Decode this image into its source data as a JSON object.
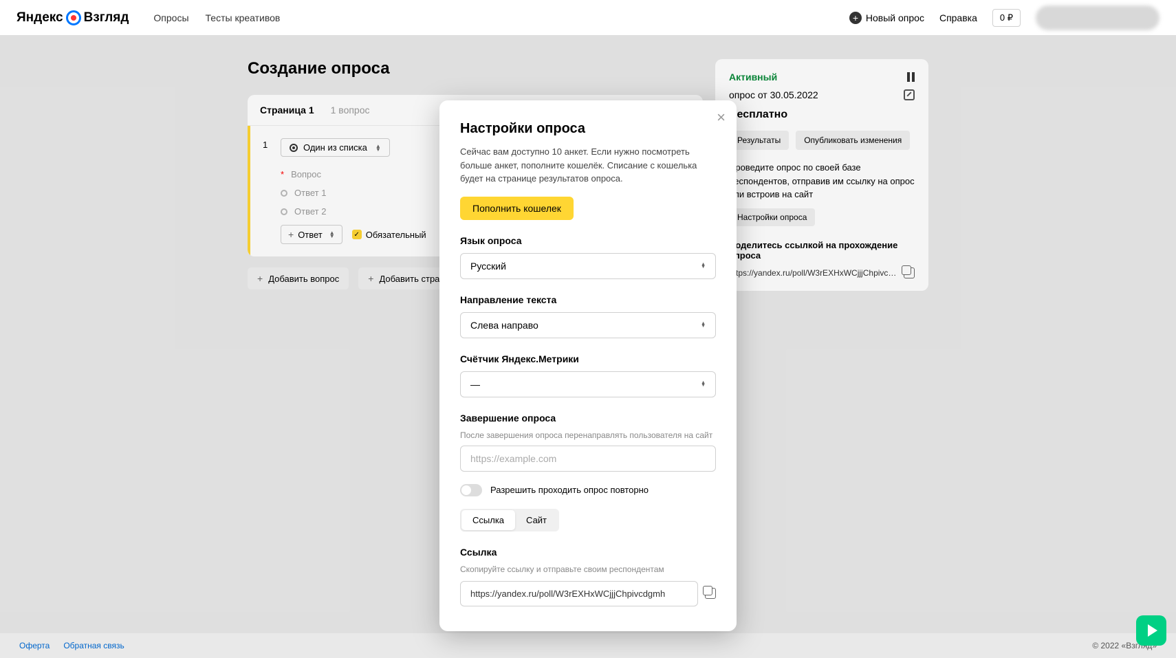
{
  "header": {
    "brand_left": "Яндекс",
    "brand_right": "Взгляд",
    "nav_surveys": "Опросы",
    "nav_creatives": "Тесты креативов",
    "new_survey": "Новый опрос",
    "help": "Справка",
    "balance": "0 ₽"
  },
  "page": {
    "title": "Создание опроса",
    "page_label": "Страница 1",
    "q_count": "1 вопрос",
    "q_number": "1",
    "q_type": "Один из списка",
    "q_prompt": "Вопрос",
    "answer1": "Ответ 1",
    "answer2": "Ответ 2",
    "add_answer": "Ответ",
    "required": "Обязательный",
    "add_question": "Добавить вопрос",
    "add_page": "Добавить страницу"
  },
  "sidebar": {
    "status": "Активный",
    "date": "опрос от 30.05.2022",
    "free": "Бесплатно",
    "results": "Результаты",
    "publish": "Опубликовать изменения",
    "desc": "Проведите опрос по своей базе респондентов, отправив им ссылку на опрос или встроив на сайт",
    "settings": "Настройки опроса",
    "share": "Поделитесь ссылкой на прохождение опроса",
    "link": "https://yandex.ru/poll/W3rEXHxWCjjjChpivcdgmh"
  },
  "modal": {
    "title": "Настройки опроса",
    "desc": "Сейчас вам доступно 10 анкет. Если нужно посмотреть больше анкет, пополните кошелёк. Списание с кошелька будет на странице результатов опроса.",
    "topup": "Пополнить кошелек",
    "lang_label": "Язык опроса",
    "lang_value": "Русский",
    "direction_label": "Направление текста",
    "direction_value": "Слева направо",
    "metrica_label": "Счётчик Яндекс.Метрики",
    "metrica_value": "—",
    "completion_label": "Завершение опроса",
    "completion_sub": "После завершения опроса перенаправлять пользователя на сайт",
    "completion_placeholder": "https://example.com",
    "repeat_toggle": "Разрешить проходить опрос повторно",
    "seg_link": "Ссылка",
    "seg_site": "Сайт",
    "link_label": "Ссылка",
    "link_sub": "Скопируйте ссылку и отправьте своим респондентам",
    "link_value": "https://yandex.ru/poll/W3rEXHxWCjjjChpivcdgmh"
  },
  "footer": {
    "oferta": "Оферта",
    "feedback": "Обратная связь",
    "copyright": "© 2022 «Взгляд»"
  }
}
